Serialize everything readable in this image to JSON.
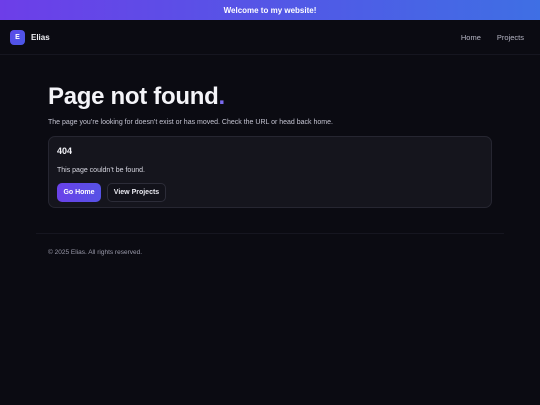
{
  "banner": {
    "text": "Welcome to my website!"
  },
  "nav": {
    "logo_letter": "E",
    "brand": "Elias",
    "links": [
      "Home",
      "Projects"
    ]
  },
  "hero": {
    "title": "Page not found",
    "title_dot": ".",
    "subtitle": "The page you’re looking for doesn’t exist or has moved. Check the URL or head back home."
  },
  "card": {
    "code": "404",
    "message": "This page couldn’t be found.",
    "primary_button": "Go Home",
    "secondary_button": "View Projects"
  },
  "footer": {
    "text": "© 2025 Elias. All rights reserved."
  },
  "colors": {
    "background": "#0b0b12",
    "accent": "#6a42e8",
    "banner_start": "#6d3ee8",
    "banner_end": "#3f6fe4"
  }
}
